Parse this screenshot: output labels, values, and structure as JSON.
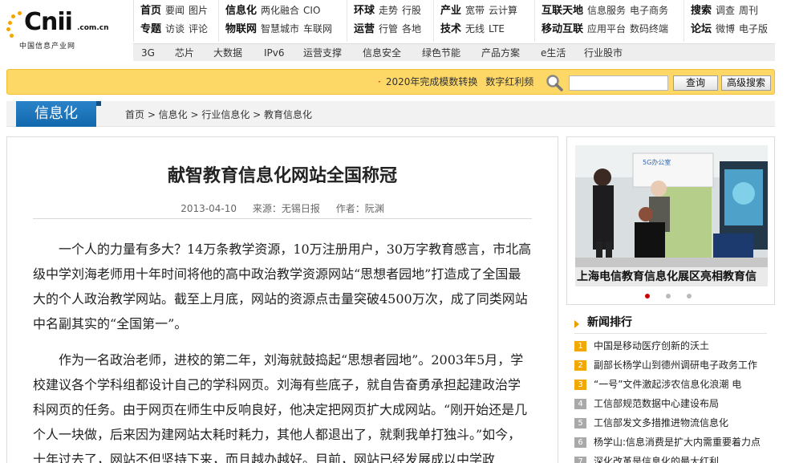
{
  "logo": {
    "word": "Cnii",
    "domain": ".com.cn",
    "subtitle": "中国信息产业网"
  },
  "topnav": [
    {
      "r1_head": "首页",
      "r1": [
        "要闻",
        "图片"
      ],
      "r2_head": "专题",
      "r2": [
        "访谈",
        "评论"
      ]
    },
    {
      "r1_head": "信息化",
      "r1": [
        "两化融合",
        "CIO"
      ],
      "r2_head": "物联网",
      "r2": [
        "智慧城市",
        "车联网"
      ]
    },
    {
      "r1_head": "环球",
      "r1": [
        "走势",
        "行股"
      ],
      "r2_head": "运营",
      "r2": [
        "行管",
        "各地"
      ]
    },
    {
      "r1_head": "产业",
      "r1": [
        "宽带",
        "云计算"
      ],
      "r2_head": "技术",
      "r2": [
        "无线",
        "LTE"
      ]
    },
    {
      "r1_head": "互联天地",
      "r1": [
        "信息服务",
        "电子商务"
      ],
      "r2_head": "移动互联",
      "r2": [
        "应用平台",
        "数码终端"
      ]
    },
    {
      "r1_head": "搜索",
      "r1": [
        "调查",
        "周刊"
      ],
      "r2_head": "论坛",
      "r2": [
        "微博",
        "电子版"
      ]
    }
  ],
  "subnav": [
    "3G",
    "芯片",
    "大数据",
    "IPv6",
    "运营支撑",
    "信息安全",
    "绿色节能",
    "产品方案",
    "e生活",
    "行业股市"
  ],
  "search": {
    "hot_items": [
      "2020年完成模数转换",
      "数字红利频"
    ],
    "query_value": "",
    "search_button": "查询",
    "advanced_button": "高级搜索"
  },
  "channel": {
    "tag": "信息化",
    "breadcrumb": "首页 > 信息化 > 行业信息化 > 教育信息化"
  },
  "article": {
    "title": "献智教育信息化网站全国称冠",
    "date": "2013-04-10",
    "source": "来源：无锡日报",
    "author": "作者：阮渊",
    "paragraphs": [
      "一个人的力量有多大？14万条教学资源，10万注册用户，30万字教育感言，市北高级中学刘海老师用十年时间将他的高中政治教学资源网站“思想者园地”打造成了全国最大的个人政治教学网站。截至上月底，网站的资源点击量突破4500万次，成了同类网站中名副其实的“全国第一”。",
      "作为一名政治老师，进校的第二年，刘海就鼓捣起“思想者园地”。2003年5月，学校建议各个学科组都设计自己的学科网页。刘海有些底子，就自告奋勇承担起建政治学科网页的任务。由于网页在师生中反响良好，他决定把网页扩大成网站。“刚开始还是几个人一块做，后来因为建网站太耗时耗力，其他人都退出了，就剩我单打独斗。”如今，十年过去了，网站不但坚持下来，而且越办越好。目前，网站已经发展成以中学政"
    ]
  },
  "photo": {
    "caption": "上海电信教育信息化展区亮相教育信",
    "sign_text": "5G办公室",
    "active_dot": 0,
    "dot_count": 3
  },
  "rank": {
    "title": "新闻排行",
    "items": [
      "中国是移动医疗创新的沃土",
      "副部长杨学山到德州调研电子政务工作",
      "“一号”文件激起涉农信息化浪潮 电",
      "工信部规范数据中心建设布局",
      "工信部发文多措推进物流信息化",
      "杨学山:信息消费是扩大内需重要着力点",
      "深化改革是信息化的最大红利"
    ]
  }
}
